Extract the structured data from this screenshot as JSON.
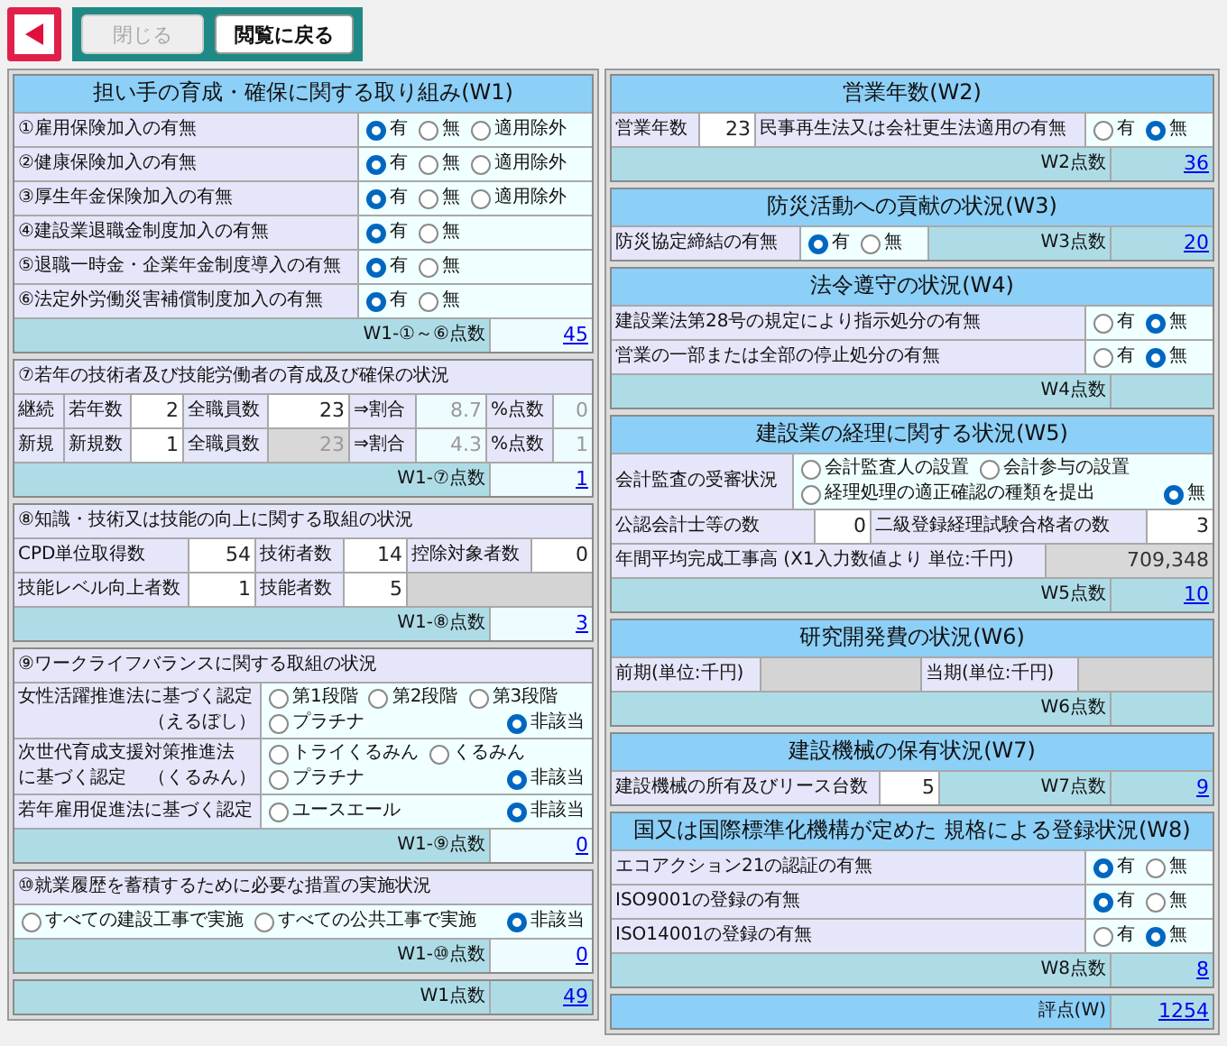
{
  "toolbar": {
    "buttons": [
      {
        "label": "閉じる",
        "disabled": true
      },
      {
        "label": "閲覧に戻る",
        "disabled": false
      }
    ]
  },
  "columns": [
    {
      "sections": [
        {
          "title": "担い手の育成・確保に関する取り組み(W1)",
          "rows": [
            {
              "kind": "question",
              "cells": [
                {
                  "kind": "label",
                  "text": "①雇用保険加入の有無"
                },
                {
                  "kind": "choice",
                  "lines": [
                    [
                      {
                        "label": "有",
                        "selected": true
                      },
                      {
                        "label": "無",
                        "selected": false
                      },
                      {
                        "label": "適用除外",
                        "selected": false
                      }
                    ]
                  ]
                }
              ]
            },
            {
              "kind": "question",
              "cells": [
                {
                  "kind": "label",
                  "text": "②健康保険加入の有無"
                },
                {
                  "kind": "choice",
                  "lines": [
                    [
                      {
                        "label": "有",
                        "selected": true
                      },
                      {
                        "label": "無",
                        "selected": false
                      },
                      {
                        "label": "適用除外",
                        "selected": false
                      }
                    ]
                  ]
                }
              ]
            },
            {
              "kind": "question",
              "cells": [
                {
                  "kind": "label",
                  "text": "③厚生年金保険加入の有無"
                },
                {
                  "kind": "choice",
                  "lines": [
                    [
                      {
                        "label": "有",
                        "selected": true
                      },
                      {
                        "label": "無",
                        "selected": false
                      },
                      {
                        "label": "適用除外",
                        "selected": false
                      }
                    ]
                  ]
                }
              ]
            },
            {
              "kind": "question",
              "cells": [
                {
                  "kind": "label",
                  "text": "④建設業退職金制度加入の有無"
                },
                {
                  "kind": "choice",
                  "lines": [
                    [
                      {
                        "label": "有",
                        "selected": true
                      },
                      {
                        "label": "無",
                        "selected": false
                      }
                    ]
                  ]
                }
              ]
            },
            {
              "kind": "question",
              "cells": [
                {
                  "kind": "label",
                  "text": "⑤退職一時金・企業年金制度導入の有無"
                },
                {
                  "kind": "choice",
                  "lines": [
                    [
                      {
                        "label": "有",
                        "selected": true
                      },
                      {
                        "label": "無",
                        "selected": false
                      }
                    ]
                  ]
                }
              ]
            },
            {
              "kind": "question",
              "cells": [
                {
                  "kind": "label",
                  "text": "⑥法定外労働災害補償制度加入の有無"
                },
                {
                  "kind": "choice",
                  "lines": [
                    [
                      {
                        "label": "有",
                        "selected": true
                      },
                      {
                        "label": "無",
                        "selected": false
                      }
                    ]
                  ]
                }
              ]
            }
          ],
          "footer": {
            "kind": "item",
            "label": "W1-①～⑥点数",
            "value": "45"
          }
        },
        {
          "rows": [
            {
              "kind": "subtitle",
              "cells": [
                {
                  "kind": "label",
                  "text": "⑦若年の技術者及び技能労働者の育成及び確保の状況"
                }
              ]
            },
            {
              "kind": "ratio",
              "cells": [
                {
                  "kind": "label",
                  "text": "継続"
                },
                {
                  "kind": "label",
                  "text": "若年数"
                },
                {
                  "kind": "input",
                  "text": "2"
                },
                {
                  "kind": "label",
                  "text": "全職員数"
                },
                {
                  "kind": "input",
                  "text": "23"
                },
                {
                  "kind": "label",
                  "text": "⇒割合"
                },
                {
                  "kind": "calc",
                  "text": "8.7"
                },
                {
                  "kind": "label",
                  "text": "%点数"
                },
                {
                  "kind": "calc",
                  "text": "0"
                }
              ]
            },
            {
              "kind": "ratio",
              "cells": [
                {
                  "kind": "label",
                  "text": "新規"
                },
                {
                  "kind": "label",
                  "text": "新規数"
                },
                {
                  "kind": "input",
                  "text": "1"
                },
                {
                  "kind": "label",
                  "text": "全職員数"
                },
                {
                  "kind": "locked",
                  "text": "23"
                },
                {
                  "kind": "label",
                  "text": "⇒割合"
                },
                {
                  "kind": "calc",
                  "text": "4.3"
                },
                {
                  "kind": "label",
                  "text": "%点数"
                },
                {
                  "kind": "calc",
                  "text": "1"
                }
              ]
            }
          ],
          "footer": {
            "kind": "item",
            "label": "W1-⑦点数",
            "value": "1"
          }
        },
        {
          "rows": [
            {
              "kind": "subtitle",
              "cells": [
                {
                  "kind": "label",
                  "text": "⑧知識・技術又は技能の向上に関する取組の状況"
                }
              ]
            },
            {
              "kind": "skill",
              "cells": [
                {
                  "kind": "label",
                  "text": "CPD単位取得数"
                },
                {
                  "kind": "input",
                  "text": "54"
                },
                {
                  "kind": "label",
                  "text": "技術者数"
                },
                {
                  "kind": "input",
                  "text": "14"
                },
                {
                  "kind": "label",
                  "text": "控除対象者数"
                },
                {
                  "kind": "input",
                  "text": "0"
                }
              ]
            },
            {
              "kind": "skill2",
              "cells": [
                {
                  "kind": "label",
                  "text": "技能レベル向上者数"
                },
                {
                  "kind": "input",
                  "text": "1"
                },
                {
                  "kind": "label",
                  "text": "技能者数"
                },
                {
                  "kind": "input",
                  "text": "5"
                },
                {
                  "kind": "empty"
                }
              ]
            }
          ],
          "footer": {
            "kind": "item",
            "label": "W1-⑧点数",
            "value": "3"
          }
        },
        {
          "rows": [
            {
              "kind": "subtitle",
              "cells": [
                {
                  "kind": "label",
                  "text": "⑨ワークライフバランスに関する取組の状況"
                }
              ]
            },
            {
              "kind": "cert",
              "cells": [
                {
                  "kind": "label",
                  "lines": [
                    [
                      "女性活躍推進法に基づく認定"
                    ],
                    [
                      "（えるぼし）"
                    ]
                  ]
                },
                {
                  "kind": "choice_split",
                  "lines": [
                    [
                      {
                        "label": "第1段階",
                        "selected": false
                      },
                      {
                        "label": "第2段階",
                        "selected": false
                      },
                      {
                        "label": "第3段階",
                        "selected": false
                      }
                    ],
                    [
                      {
                        "label": "プラチナ",
                        "selected": false
                      },
                      {
                        "label": "非該当",
                        "selected": true
                      }
                    ]
                  ]
                }
              ]
            },
            {
              "kind": "cert",
              "cells": [
                {
                  "kind": "label",
                  "lines": [
                    [
                      "次世代育成支援対策推進法"
                    ],
                    [
                      "に基づく認定",
                      "（くるみん）"
                    ]
                  ]
                },
                {
                  "kind": "choice_split",
                  "lines": [
                    [
                      {
                        "label": "トライくるみん",
                        "selected": false
                      },
                      {
                        "label": "くるみん",
                        "selected": false
                      }
                    ],
                    [
                      {
                        "label": "プラチナ",
                        "selected": false
                      },
                      {
                        "label": "非該当",
                        "selected": true
                      }
                    ]
                  ]
                }
              ]
            },
            {
              "kind": "cert",
              "cells": [
                {
                  "kind": "label",
                  "text": "若年雇用促進法に基づく認定"
                },
                {
                  "kind": "choice_split",
                  "lines": [
                    [
                      {
                        "label": "ユースエール",
                        "selected": false
                      },
                      {
                        "label": "非該当",
                        "selected": true
                      }
                    ]
                  ]
                }
              ]
            }
          ],
          "footer": {
            "kind": "item",
            "label": "W1-⑨点数",
            "value": "0"
          }
        },
        {
          "rows": [
            {
              "kind": "subtitle",
              "cells": [
                {
                  "kind": "label",
                  "text": "⑩就業履歴を蓄積するために必要な措置の実施状況"
                }
              ]
            },
            {
              "kind": "subtitle",
              "cells": [
                {
                  "kind": "choice_split",
                  "lines": [
                    [
                      {
                        "label": "すべての建設工事で実施",
                        "selected": false
                      },
                      {
                        "label": "すべての公共工事で実施",
                        "selected": false
                      },
                      {
                        "label": "非該当",
                        "selected": true
                      }
                    ]
                  ]
                }
              ]
            }
          ],
          "footer": {
            "kind": "item",
            "label": "W1-⑩点数",
            "value": "0"
          }
        },
        {
          "footer": {
            "kind": "section",
            "label": "W1点数",
            "value": "49"
          }
        }
      ]
    },
    {
      "sections": [
        {
          "title": "営業年数(W2)",
          "rows": [
            {
              "kind": "years",
              "cells": [
                {
                  "kind": "label",
                  "text": "営業年数"
                },
                {
                  "kind": "input",
                  "text": "23"
                },
                {
                  "kind": "label",
                  "text": "民事再生法又は会社更生法適用の有無"
                },
                {
                  "kind": "choice",
                  "lines": [
                    [
                      {
                        "label": "有",
                        "selected": false
                      },
                      {
                        "label": "無",
                        "selected": true
                      }
                    ]
                  ]
                }
              ]
            }
          ],
          "footer": {
            "kind": "section",
            "label": "W2点数",
            "value": "36"
          }
        },
        {
          "title": "防災活動への貢献の状況(W3)",
          "rows": [
            {
              "kind": "pledge",
              "cells": [
                {
                  "kind": "label",
                  "text": "防災協定締結の有無"
                },
                {
                  "kind": "choice",
                  "lines": [
                    [
                      {
                        "label": "有",
                        "selected": true
                      },
                      {
                        "label": "無",
                        "selected": false
                      }
                    ]
                  ]
                },
                {
                  "kind": "score_label",
                  "text": "W3点数"
                },
                {
                  "kind": "score",
                  "text": "20"
                }
              ]
            }
          ]
        },
        {
          "title": "法令遵守の状況(W4)",
          "rows": [
            {
              "kind": "yesno",
              "cells": [
                {
                  "kind": "label",
                  "text": "建設業法第28号の規定により指示処分の有無"
                },
                {
                  "kind": "choice",
                  "lines": [
                    [
                      {
                        "label": "有",
                        "selected": false
                      },
                      {
                        "label": "無",
                        "selected": true
                      }
                    ]
                  ]
                }
              ]
            },
            {
              "kind": "yesno",
              "cells": [
                {
                  "kind": "label",
                  "text": "営業の一部または全部の停止処分の有無"
                },
                {
                  "kind": "choice",
                  "lines": [
                    [
                      {
                        "label": "有",
                        "selected": false
                      },
                      {
                        "label": "無",
                        "selected": true
                      }
                    ]
                  ]
                }
              ]
            }
          ],
          "footer": {
            "kind": "section",
            "label": "W4点数"
          }
        },
        {
          "title": "建設業の経理に関する状況(W5)",
          "rows": [
            {
              "kind": "audit",
              "cells": [
                {
                  "kind": "label",
                  "text": "会計監査の受審状況"
                },
                {
                  "kind": "choice_split",
                  "lines": [
                    [
                      {
                        "label": "会計監査人の設置",
                        "selected": false
                      },
                      {
                        "label": "会計参与の設置",
                        "selected": false
                      }
                    ],
                    [
                      {
                        "label": "経理処理の適正確認の種類を提出",
                        "selected": false
                      },
                      {
                        "label": "無",
                        "selected": true
                      }
                    ]
                  ]
                }
              ]
            },
            {
              "kind": "accountants",
              "cells": [
                {
                  "kind": "label",
                  "text": "公認会計士等の数"
                },
                {
                  "kind": "input",
                  "text": "0"
                },
                {
                  "kind": "label",
                  "text": "二級登録経理試験合格者の数"
                },
                {
                  "kind": "input",
                  "text": "3"
                }
              ]
            },
            {
              "kind": "revenue",
              "cells": [
                {
                  "kind": "label",
                  "text": "年間平均完成工事高 (X1入力数値より 単位:千円)"
                },
                {
                  "kind": "readonly",
                  "text": "709,348"
                }
              ]
            }
          ],
          "footer": {
            "kind": "section",
            "label": "W5点数",
            "value": "10"
          }
        },
        {
          "title": "研究開発費の状況(W6)",
          "rows": [
            {
              "kind": "research",
              "cells": [
                {
                  "kind": "label",
                  "text": "前期(単位:千円)"
                },
                {
                  "kind": "empty"
                },
                {
                  "kind": "label",
                  "text": "当期(単位:千円)"
                },
                {
                  "kind": "empty"
                }
              ]
            }
          ],
          "footer": {
            "kind": "section",
            "label": "W6点数"
          }
        },
        {
          "title": "建設機械の保有状況(W7)",
          "rows": [
            {
              "kind": "machines",
              "cells": [
                {
                  "kind": "label",
                  "text": "建設機械の所有及びリース台数"
                },
                {
                  "kind": "input",
                  "text": "5"
                },
                {
                  "kind": "score_label",
                  "text": "W7点数"
                },
                {
                  "kind": "score",
                  "text": "9"
                }
              ]
            }
          ]
        },
        {
          "title": "国又は国際標準化機構が定めた 規格による登録状況(W8)",
          "rows": [
            {
              "kind": "yesno",
              "cells": [
                {
                  "kind": "label",
                  "text": "エコアクション21の認証の有無"
                },
                {
                  "kind": "choice",
                  "lines": [
                    [
                      {
                        "label": "有",
                        "selected": true
                      },
                      {
                        "label": "無",
                        "selected": false
                      }
                    ]
                  ]
                }
              ]
            },
            {
              "kind": "yesno",
              "cells": [
                {
                  "kind": "label",
                  "text": "ISO9001の登録の有無"
                },
                {
                  "kind": "choice",
                  "lines": [
                    [
                      {
                        "label": "有",
                        "selected": true
                      },
                      {
                        "label": "無",
                        "selected": false
                      }
                    ]
                  ]
                }
              ]
            },
            {
              "kind": "yesno",
              "cells": [
                {
                  "kind": "label",
                  "text": "ISO14001の登録の有無"
                },
                {
                  "kind": "choice",
                  "lines": [
                    [
                      {
                        "label": "有",
                        "selected": false
                      },
                      {
                        "label": "無",
                        "selected": true
                      }
                    ]
                  ]
                }
              ]
            }
          ],
          "footer": {
            "kind": "section",
            "label": "W8点数",
            "value": "8"
          }
        },
        {
          "footer": {
            "kind": "total",
            "label": "評点(W)",
            "value": "1254"
          }
        }
      ]
    }
  ]
}
